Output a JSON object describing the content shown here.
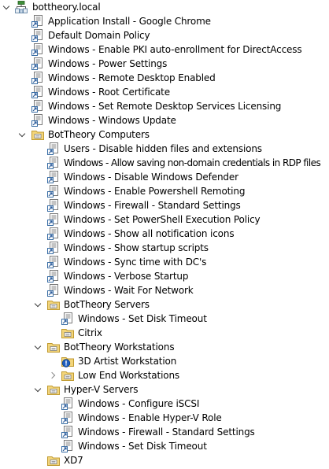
{
  "tree": {
    "root": {
      "label": "bottheory.local",
      "icon": "domain-icon"
    },
    "items": [
      {
        "label": "Application Install - Google Chrome",
        "icon": "gpo-link-icon"
      },
      {
        "label": "Default Domain Policy",
        "icon": "gpo-link-icon"
      },
      {
        "label": "Windows - Enable PKI auto-enrollment for DirectAccess",
        "icon": "gpo-link-icon"
      },
      {
        "label": "Windows - Power Settings",
        "icon": "gpo-link-icon"
      },
      {
        "label": "Windows - Remote Desktop Enabled",
        "icon": "gpo-link-icon"
      },
      {
        "label": "Windows - Root Certificate",
        "icon": "gpo-link-icon"
      },
      {
        "label": "Windows - Set Remote Desktop Services Licensing",
        "icon": "gpo-link-icon"
      },
      {
        "label": "Windows - Windows Update",
        "icon": "gpo-link-icon"
      },
      {
        "label": "BotTheory Computers",
        "icon": "ou-folder-icon"
      },
      {
        "label": "Users - Disable hidden files and extensions",
        "icon": "gpo-link-icon"
      },
      {
        "label": "Windows - Allow saving non-domain credentials in RDP files",
        "icon": "gpo-link-icon"
      },
      {
        "label": "Windows - Disable Windows Defender",
        "icon": "gpo-link-icon"
      },
      {
        "label": "Windows - Enable Powershell Remoting",
        "icon": "gpo-link-icon"
      },
      {
        "label": "Windows - Firewall - Standard Settings",
        "icon": "gpo-link-icon"
      },
      {
        "label": "Windows - Set PowerShell Execution Policy",
        "icon": "gpo-link-icon"
      },
      {
        "label": "Windows - Show all notification icons",
        "icon": "gpo-link-icon"
      },
      {
        "label": "Windows - Show startup scripts",
        "icon": "gpo-link-icon"
      },
      {
        "label": "Windows - Sync time with DC's",
        "icon": "gpo-link-icon"
      },
      {
        "label": "Windows - Verbose Startup",
        "icon": "gpo-link-icon"
      },
      {
        "label": "Windows - Wait For Network",
        "icon": "gpo-link-icon"
      },
      {
        "label": "BotTheory Servers",
        "icon": "ou-folder-icon"
      },
      {
        "label": "Windows - Set Disk Timeout",
        "icon": "gpo-link-icon"
      },
      {
        "label": "Citrix",
        "icon": "ou-folder-icon"
      },
      {
        "label": "BotTheory Workstations",
        "icon": "ou-folder-icon"
      },
      {
        "label": "3D Artist Workstation",
        "icon": "ou-folder-blocked-icon"
      },
      {
        "label": "Low End Workstations",
        "icon": "ou-folder-icon"
      },
      {
        "label": "Hyper-V Servers",
        "icon": "ou-folder-icon"
      },
      {
        "label": "Windows - Configure iSCSI",
        "icon": "gpo-link-icon"
      },
      {
        "label": "Windows - Enable Hyper-V Role",
        "icon": "gpo-link-icon"
      },
      {
        "label": "Windows - Firewall - Standard Settings",
        "icon": "gpo-link-icon"
      },
      {
        "label": "Windows - Set Disk Timeout",
        "icon": "gpo-link-icon"
      },
      {
        "label": "XD7",
        "icon": "ou-folder-icon"
      }
    ]
  }
}
